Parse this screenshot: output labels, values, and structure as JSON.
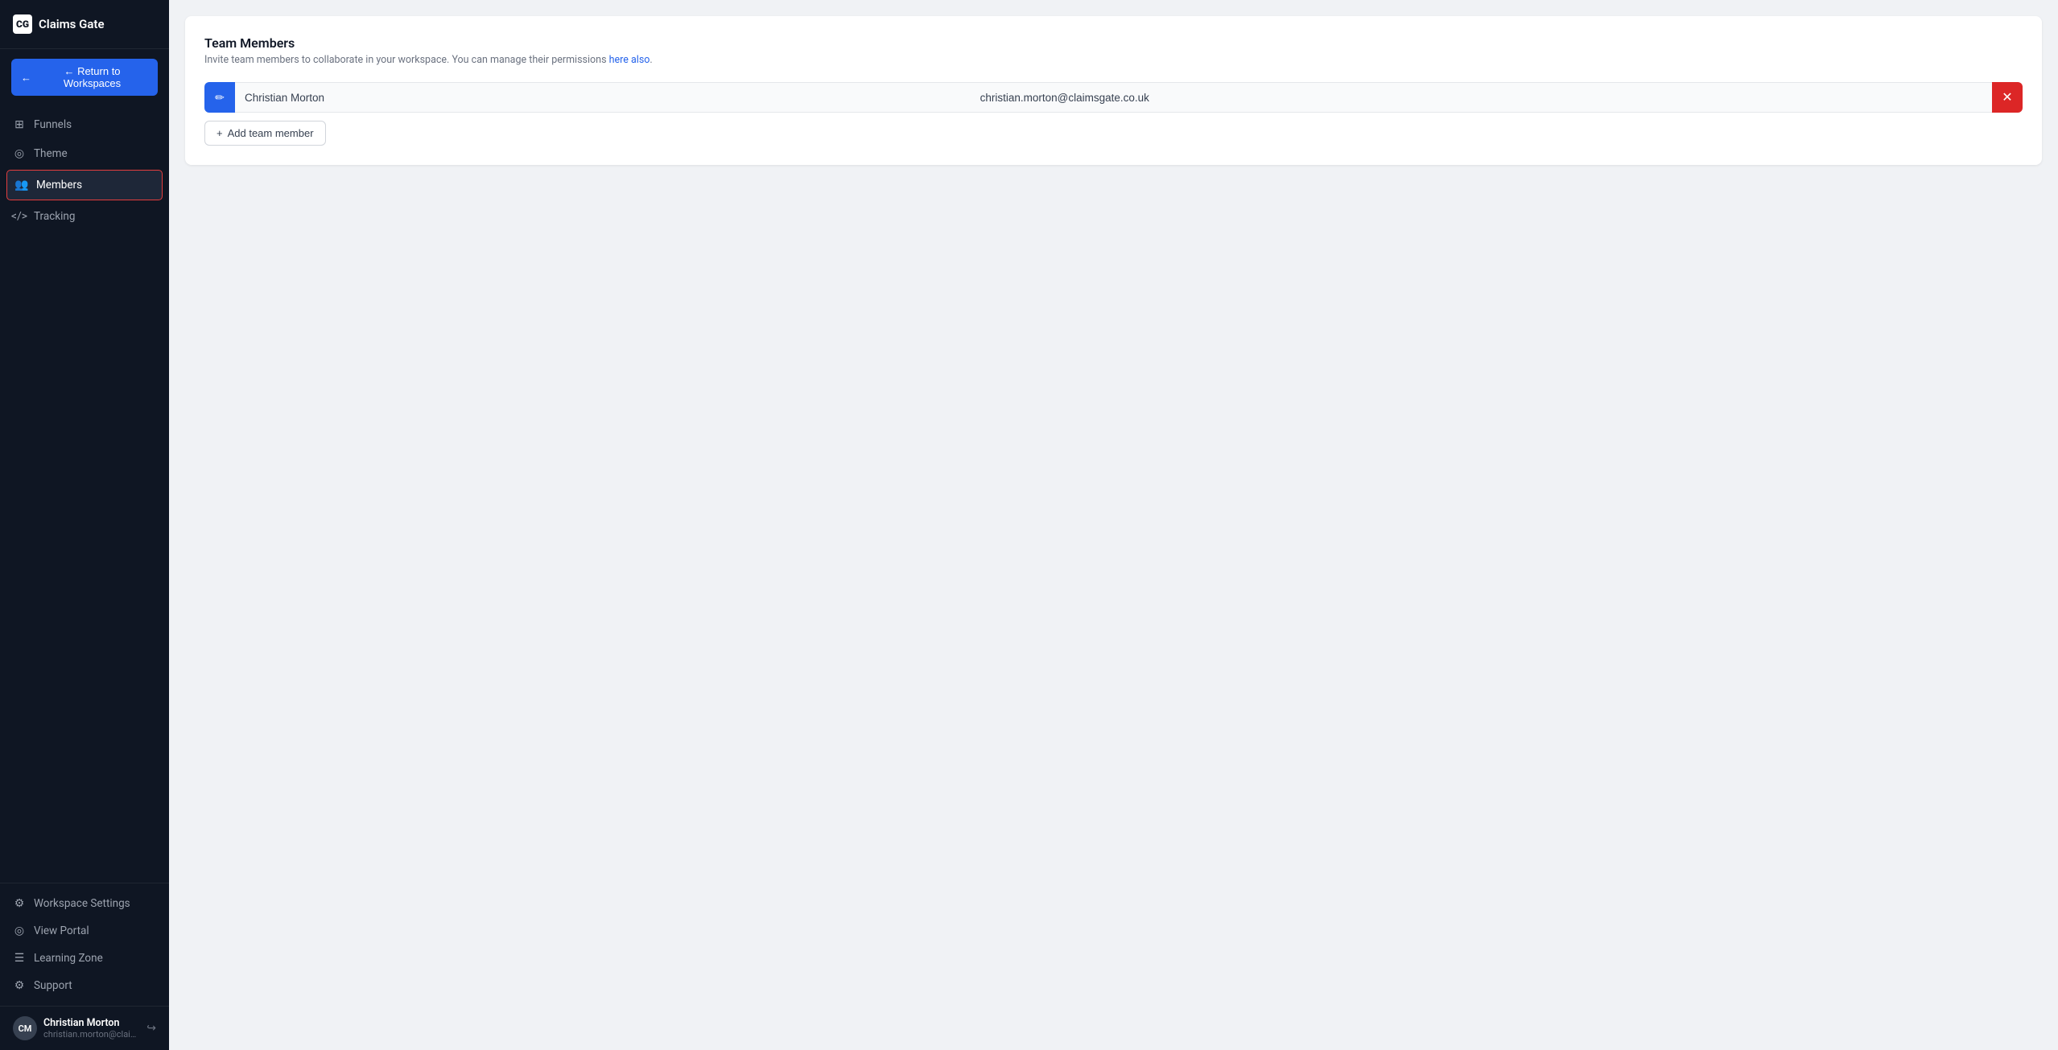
{
  "app": {
    "title": "Claims Gate",
    "logo_text": "CG"
  },
  "sidebar": {
    "return_button": "← Return to Workspaces",
    "nav_items": [
      {
        "id": "funnels",
        "label": "Funnels",
        "icon": "⊞",
        "active": false
      },
      {
        "id": "theme",
        "label": "Theme",
        "icon": "◎",
        "active": false
      },
      {
        "id": "members",
        "label": "Members",
        "icon": "👥",
        "active": true
      },
      {
        "id": "tracking",
        "label": "Tracking",
        "icon": "</>",
        "active": false
      }
    ],
    "bottom_items": [
      {
        "id": "workspace-settings",
        "label": "Workspace Settings",
        "icon": "⚙"
      },
      {
        "id": "view-portal",
        "label": "View Portal",
        "icon": "◎"
      },
      {
        "id": "learning-zone",
        "label": "Learning Zone",
        "icon": "☰"
      },
      {
        "id": "support",
        "label": "Support",
        "icon": "⚙"
      }
    ],
    "user": {
      "name": "Christian Morton",
      "email": "christian.morton@claims..",
      "initials": "CM"
    }
  },
  "main": {
    "section_title": "Team Members",
    "section_subtitle": "Invite team members to collaborate in your workspace. You can manage their permissions here also.",
    "subtitle_link_text": "here also",
    "members": [
      {
        "name": "Christian Morton",
        "email": "christian.morton@claimsgate.co.uk"
      }
    ],
    "add_member_label": "+ Add team member"
  }
}
